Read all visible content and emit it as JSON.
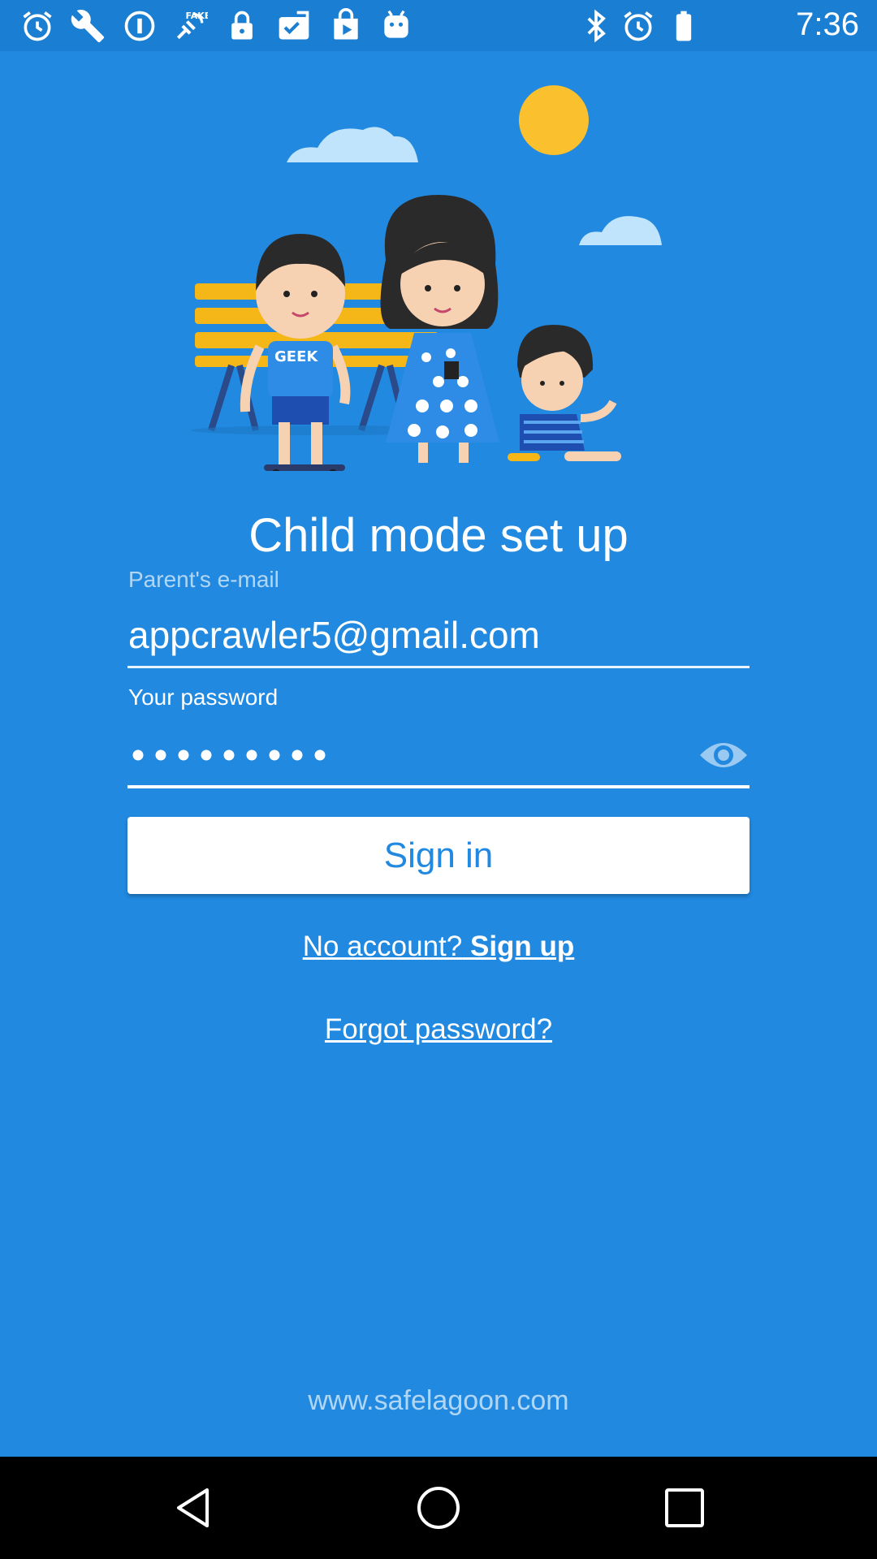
{
  "status_bar": {
    "time": "7:36",
    "left_icons": [
      "alarm-icon",
      "wrench-icon",
      "info-icon",
      "fake-gps-icon",
      "lock-icon",
      "checklist-icon",
      "play-store-icon",
      "android-icon"
    ],
    "right_icons": [
      "bluetooth-icon",
      "alarm-icon"
    ]
  },
  "screen": {
    "title": "Child mode set up",
    "email_label": "Parent's e-mail",
    "email_value": "appcrawler5@gmail.com",
    "password_label": "Your password",
    "password_masked": "••••••••••",
    "password_toggle_icon": "eye-icon",
    "signin_label": "Sign in",
    "signup_prefix": "No account?",
    "signup_link": "Sign up",
    "forgot_label": "Forgot password?",
    "footer_url": "www.safelagoon.com"
  },
  "illustration": {
    "shirt_text": "GEEK"
  },
  "nav_bar": {
    "icons": [
      "back-icon",
      "home-icon",
      "recents-icon"
    ]
  },
  "colors": {
    "background": "#2189e0",
    "status_bar": "#1a7ed3",
    "button_bg": "#ffffff",
    "button_text": "#2189e0",
    "sun": "#fbc02d",
    "bench": "#f5b617",
    "cloud": "#bfe4fb"
  }
}
